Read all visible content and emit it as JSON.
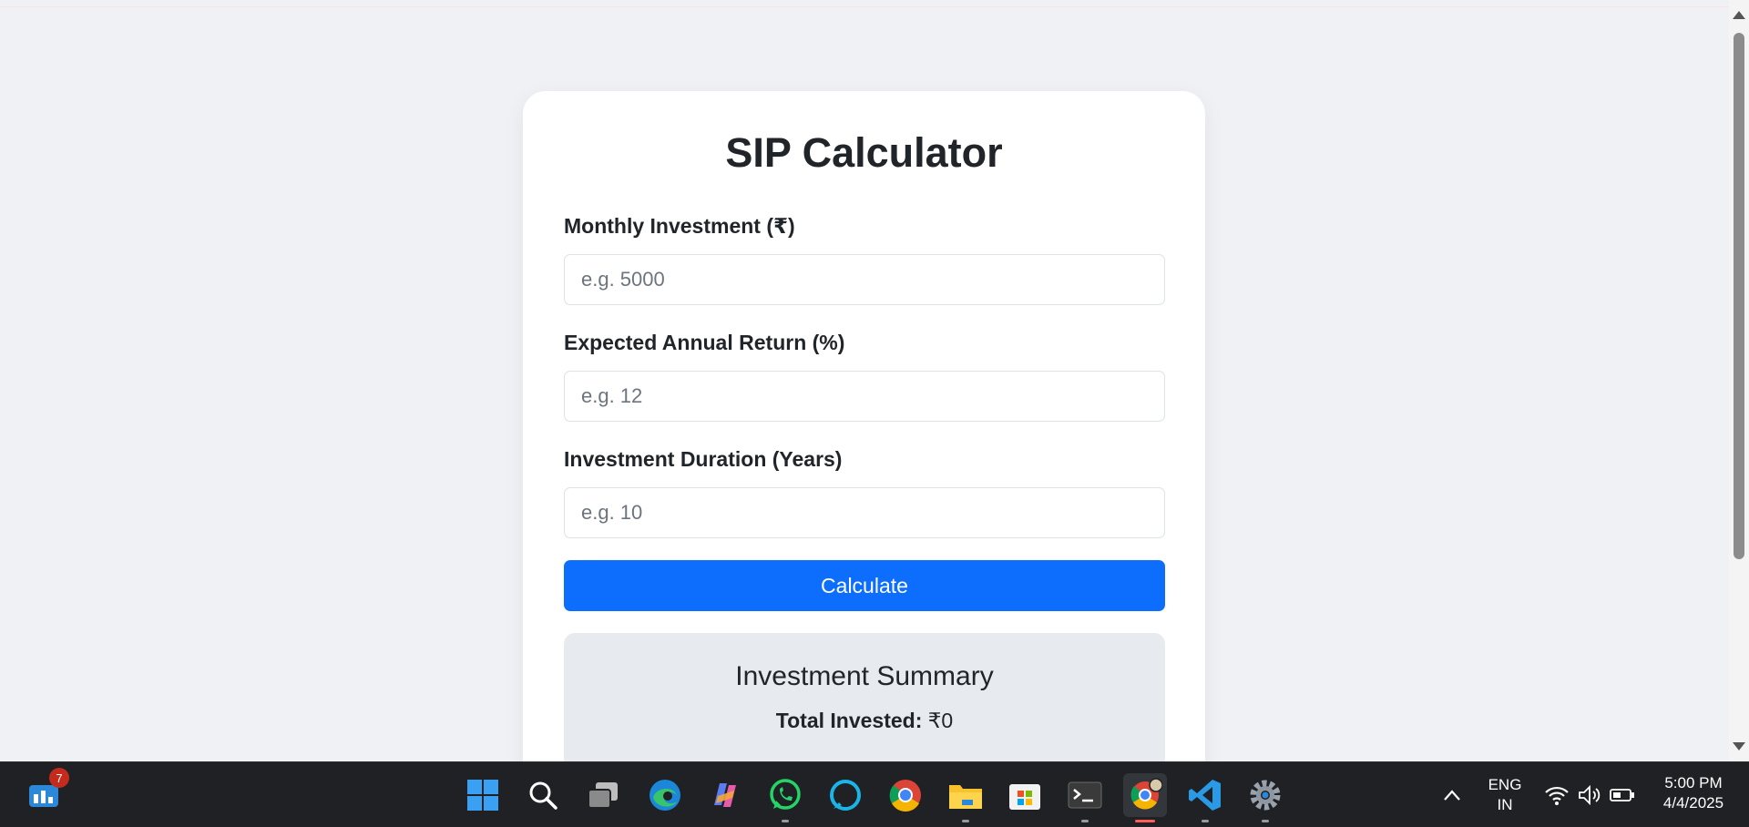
{
  "calculator": {
    "title": "SIP Calculator",
    "monthly_label": "Monthly Investment (₹)",
    "monthly_placeholder": "e.g. 5000",
    "return_label": "Expected Annual Return (%)",
    "return_placeholder": "e.g. 12",
    "duration_label": "Investment Duration (Years)",
    "duration_placeholder": "e.g. 10",
    "calculate_label": "Calculate"
  },
  "summary": {
    "title": "Investment Summary",
    "total_invested_label": "Total Invested:",
    "total_invested_value": "₹0"
  },
  "colors": {
    "accent": "#0d6efd",
    "page_bg": "#f0f1f5",
    "summary_bg": "#e7eaee",
    "taskbar_bg": "#1f2124"
  },
  "taskbar": {
    "widgets_badge": "7",
    "apps": [
      "start-icon",
      "search-icon",
      "task-view-icon",
      "edge-icon",
      "copilot-icon",
      "whatsapp-icon",
      "alexa-icon",
      "chrome-icon",
      "file-explorer-icon",
      "store-icon",
      "terminal-icon",
      "chrome-profile-icon",
      "vscode-icon",
      "settings-icon"
    ],
    "lang_line1": "ENG",
    "lang_line2": "IN",
    "time": "5:00 PM",
    "date": "4/4/2025"
  }
}
